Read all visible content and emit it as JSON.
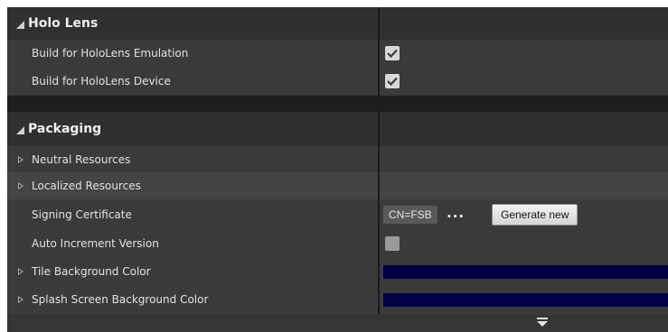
{
  "categories": {
    "holo_lens": {
      "label": "Holo Lens"
    },
    "packaging": {
      "label": "Packaging"
    }
  },
  "holo_lens": {
    "emulation": {
      "label": "Build for HoloLens Emulation",
      "checked": true
    },
    "device": {
      "label": "Build for HoloLens Device",
      "checked": true
    }
  },
  "packaging": {
    "neutral_resources": {
      "label": "Neutral Resources"
    },
    "localized_resources": {
      "label": "Localized Resources"
    },
    "signing_certificate": {
      "label": "Signing Certificate",
      "value": "CN=FSB",
      "browse_label": "...",
      "generate_label": "Generate new"
    },
    "auto_increment": {
      "label": "Auto Increment Version",
      "checked": false
    },
    "tile_bg": {
      "label": "Tile Background Color",
      "color": "#000046"
    },
    "splash_bg": {
      "label": "Splash Screen Background Color",
      "color": "#000046"
    }
  },
  "icons": {
    "category_expanded": "triangle-expanded-icon",
    "collapsed": "chevron-right-icon",
    "check": "check-icon",
    "scroll_down": "arrow-down-icon"
  }
}
